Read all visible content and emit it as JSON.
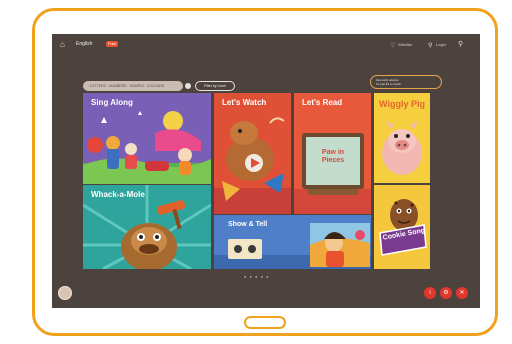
{
  "topbar": {
    "language_label": "English",
    "language_badge": "Free",
    "nav_item_1": "Wishlist",
    "nav_item_2": "Login"
  },
  "filter": {
    "text": "· LETTERS · NUMBERS · SHAPES · COLOURS",
    "button_label": "Filter by Level"
  },
  "promo": {
    "line1": "Get early access",
    "line2": "for just $1 a month"
  },
  "tiles": {
    "sing_along": "Sing Along",
    "lets_watch": "Let's Watch",
    "lets_read": "Let's Read",
    "wiggly_pig": "Wiggly Pig",
    "whack_a_mole": "Whack-a-Mole",
    "show_tell": "Show & Tell",
    "cookie_song": "Cookie Song",
    "book_title": "Paw in Pieces"
  },
  "pager": "● ● ● ● ●",
  "colors": {
    "frame_orange": "#f0a21e",
    "screen_bg": "#4c433f",
    "accent_red": "#e0362c"
  }
}
